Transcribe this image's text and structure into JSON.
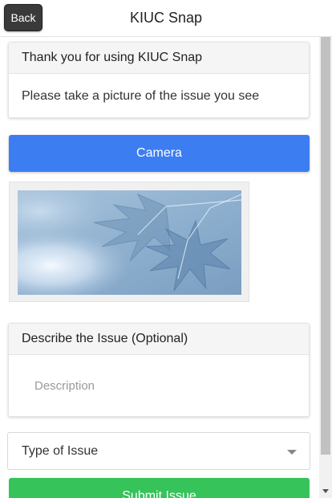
{
  "header": {
    "back_label": "Back",
    "title": "KIUC Snap"
  },
  "intro_card": {
    "heading": "Thank you for using KIUC Snap",
    "body": "Please take a picture of the issue you see"
  },
  "camera": {
    "label": "Camera"
  },
  "description_card": {
    "heading": "Describe the Issue (Optional)",
    "placeholder": "Description"
  },
  "issue_type": {
    "label": "Type of Issue"
  },
  "submit": {
    "label": "Submit Issue"
  },
  "colors": {
    "camera_button": "#3c7df2",
    "submit_button": "#35c35a",
    "back_button": "#3a3a3a"
  }
}
